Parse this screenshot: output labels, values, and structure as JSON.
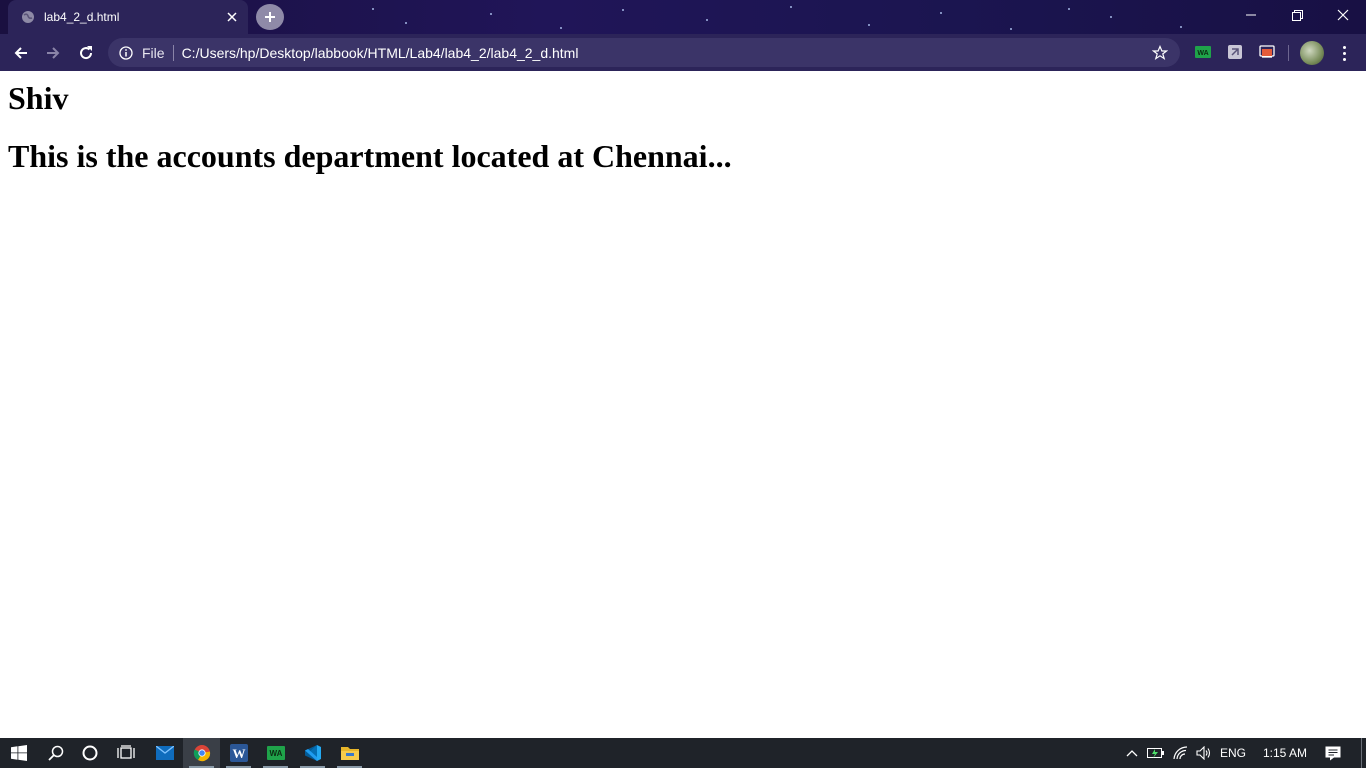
{
  "browser": {
    "tab": {
      "title": "lab4_2_d.html"
    },
    "omnibox": {
      "scheme_label": "File",
      "url": "C:/Users/hp/Desktop/labbook/HTML/Lab4/lab4_2/lab4_2_d.html"
    },
    "extensions": [
      "whatsapp-extension-icon",
      "extension-puzzle-icon",
      "cast-icon"
    ]
  },
  "page": {
    "heading_name": "Shiv",
    "heading_description": "This is the accounts department located at Chennai..."
  },
  "taskbar": {
    "apps": [
      "start-icon",
      "search-icon",
      "cortana-icon",
      "task-view-icon",
      "mail-icon",
      "chrome-icon",
      "word-icon",
      "whatsapp-icon",
      "vscode-icon",
      "file-explorer-icon"
    ],
    "active_app": "chrome-icon",
    "tray": {
      "language": "ENG",
      "time": "1:15 AM"
    }
  },
  "colors": {
    "titlebar": "#1a1040",
    "toolbar": "#2c2459",
    "omnibox": "#3b3468",
    "taskbar": "#1f2329"
  }
}
